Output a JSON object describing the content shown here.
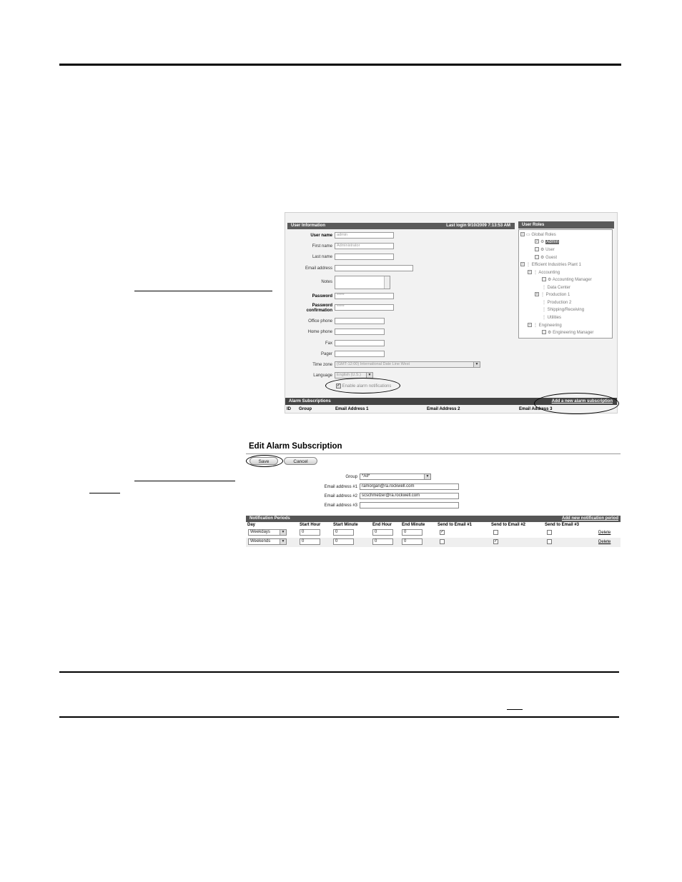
{
  "user_info": {
    "header": "User Information",
    "last_login": "Last login 9/10/2009 7:13:53 AM",
    "fields": [
      {
        "label": "User name",
        "value": "admin",
        "bold": true
      },
      {
        "label": "First name",
        "value": "Administrator",
        "bold": false
      },
      {
        "label": "Last name",
        "value": "",
        "bold": false
      },
      {
        "label": "Email address",
        "value": "",
        "bold": false
      },
      {
        "label": "Notes",
        "value": "",
        "bold": false
      },
      {
        "label": "Password",
        "value": "*****",
        "bold": true
      },
      {
        "label": "Password confirmation",
        "value": "*****",
        "bold": true
      },
      {
        "label": "Office phone",
        "value": "",
        "bold": false
      },
      {
        "label": "Home phone",
        "value": "",
        "bold": false
      },
      {
        "label": "Fax",
        "value": "",
        "bold": false
      },
      {
        "label": "Pager",
        "value": "",
        "bold": false
      },
      {
        "label": "Time zone",
        "value": "(GMT-12:00) International Date Line West",
        "bold": false
      },
      {
        "label": "Language",
        "value": "English (U.S.)",
        "bold": false
      }
    ],
    "enable_alarm_label": "Enable alarm notifications",
    "enable_alarm_checked": true
  },
  "user_roles": {
    "header": "User Roles",
    "tree": {
      "global_roles": "Global Roles",
      "admin": "Admin",
      "user": "User",
      "guest": "Guest",
      "plant": "Efficient Industries Plant 1",
      "accounting": "Accounting",
      "accounting_manager": "Accounting Manager",
      "data_center": "Data Center",
      "production1": "Production 1",
      "production2": "Production 2",
      "shipping": "Shipping/Receiving",
      "utilities": "Utilities",
      "engineering": "Engineering",
      "engineering_manager": "Engineering Manager"
    }
  },
  "alarm_subscriptions": {
    "header": "Alarm Subscriptions",
    "add_link": "Add a new alarm subscription",
    "columns": [
      "ID",
      "Group",
      "Email Address 1",
      "Email Address 2",
      "Email Address 3"
    ]
  },
  "edit_alarm": {
    "title": "Edit Alarm Subscription",
    "save_label": "Save",
    "cancel_label": "Cancel",
    "group_label": "Group",
    "group_value": "*All*",
    "email1_label": "Email address #1",
    "email1_value": "ramorgan@ra.rockwell.com",
    "email2_label": "Email address #2",
    "email2_value": "scschmelzer@ra.rockwell.com",
    "email3_label": "Email address #3",
    "email3_value": ""
  },
  "notification_periods": {
    "header": "Notification Periods",
    "add_link": "Add new notification period",
    "columns": [
      "Day",
      "Start Hour",
      "Start Minute",
      "End Hour",
      "End Minute",
      "Send to Email #1",
      "Send to Email #2",
      "Send to Email #3"
    ],
    "rows": [
      {
        "day": "Weekdays",
        "start_hour": "0",
        "start_minute": "0",
        "end_hour": "0",
        "end_minute": "0",
        "email1": true,
        "email2": false,
        "email3": false,
        "delete": "Delete"
      },
      {
        "day": "Weekends",
        "start_hour": "0",
        "start_minute": "0",
        "end_hour": "0",
        "end_minute": "0",
        "email1": false,
        "email2": true,
        "email3": false,
        "delete": "Delete"
      }
    ]
  }
}
